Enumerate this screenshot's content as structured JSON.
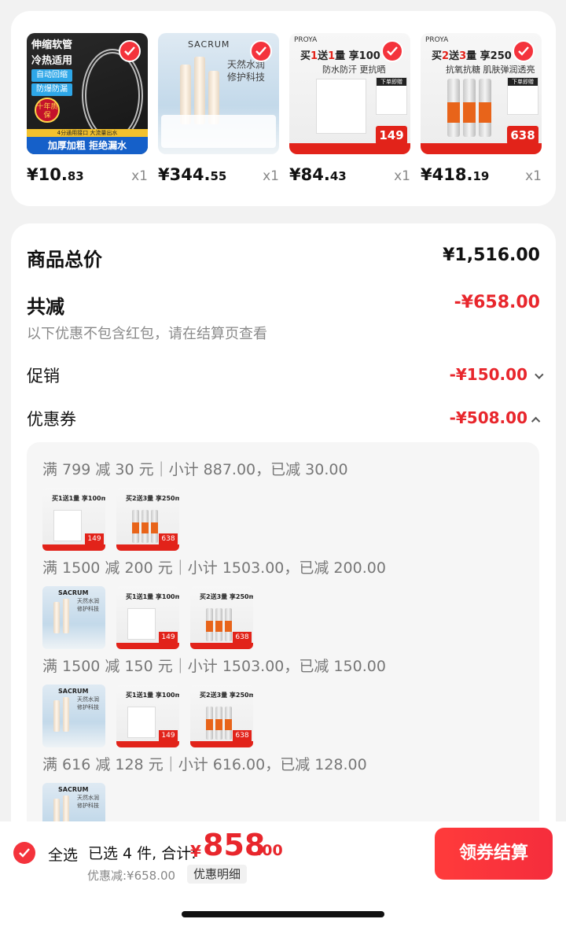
{
  "products": [
    {
      "price_int": "¥10.",
      "price_dec": "83",
      "qty": "x1",
      "thumb": {
        "lines": [
          "伸缩软管",
          "冷热适用"
        ],
        "tags": [
          "自动回缩",
          "防爆防漏"
        ],
        "badge": "十年质保",
        "note": "4分通用接口 大流量出水",
        "bottom": "加厚加粗 拒绝漏水"
      }
    },
    {
      "price_int": "¥344.",
      "price_dec": "55",
      "qty": "x1",
      "thumb": {
        "brand": "SACRUM",
        "lines": [
          "天然水润",
          "修护科技"
        ]
      }
    },
    {
      "price_int": "¥84.",
      "price_dec": "43",
      "qty": "x1",
      "thumb": {
        "brand": "PROYA",
        "banner_a": "买",
        "banner_b": "1",
        "banner_c": "送",
        "banner_d": "1",
        "banner_e": "量 享100",
        "sub": "防水防汗 更抗晒",
        "gift": "下单即赠",
        "price": "149"
      }
    },
    {
      "price_int": "¥418.",
      "price_dec": "19",
      "qty": "x1",
      "thumb": {
        "brand": "PROYA",
        "banner_a": "买",
        "banner_b": "2",
        "banner_c": "送",
        "banner_d": "3",
        "banner_e": "量 享250",
        "sub": "抗氧抗糖 肌肤弹润透亮",
        "gift": "下单即赠",
        "price": "638"
      }
    }
  ],
  "summary": {
    "total_label": "商品总价",
    "total_value": "¥1,516.00",
    "reduce_label": "共减",
    "reduce_value": "-¥658.00",
    "reduce_note": "以下优惠不包含红包，请在结算页查看",
    "promo_label": "促销",
    "promo_value": "-¥150.00",
    "coupon_label": "优惠券",
    "coupon_value": "-¥508.00"
  },
  "coupons": [
    {
      "title": "满 799 减 30 元｜小计 887.00，已减 30.00"
    },
    {
      "title": "满 1500 减 200 元｜小计 1503.00，已减 200.00"
    },
    {
      "title": "满 1500 减 150 元｜小计 1503.00，已减 150.00"
    },
    {
      "title": "满 616 减 128 元｜小计 616.00，已减 128.00"
    }
  ],
  "mini_labels": {
    "b_banner": "买1送1量 享100ml",
    "c_banner": "买2送3量 享250ml",
    "b_price": "149",
    "c_price": "638",
    "a_brand": "SACRUM",
    "a_text": "天然水润 修护科技"
  },
  "bottom_bar": {
    "select_all": "全选",
    "selected": "已选 4 件, 合计:",
    "currency": "¥",
    "total_int": "858",
    "total_dec": ".00",
    "discount": "优惠减:¥658.00",
    "detail": "优惠明细",
    "checkout": "领券结算"
  },
  "colors": {
    "accent_red": "#e8262c",
    "check_red": "#f4333c"
  }
}
